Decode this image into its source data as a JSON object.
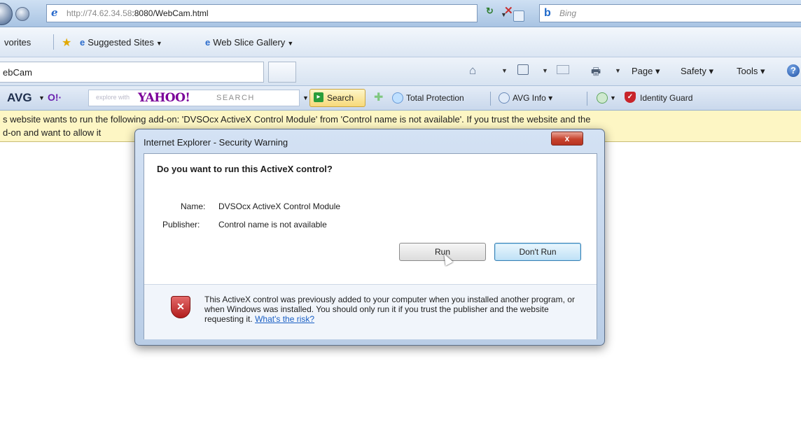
{
  "browser": {
    "url_host": "http://74.62.34.58",
    "url_path": ":8080/WebCam.html",
    "search_placeholder": "Bing"
  },
  "favorites_bar": {
    "label": "vorites",
    "suggested_sites": "Suggested Sites",
    "web_slice_gallery": "Web Slice Gallery"
  },
  "tab": {
    "title": "ebCam"
  },
  "command_bar": {
    "page": "Page ▾",
    "safety": "Safety ▾",
    "tools": "Tools ▾",
    "help": "?"
  },
  "avg_toolbar": {
    "logo": "AVG",
    "yahoo_hint": "explore with",
    "yahoo_logo": "YAHOO!",
    "yahoo_search": "SEARCH",
    "search_button": "Search",
    "total_protection": "Total Protection",
    "avg_info": "AVG Info ▾",
    "identity_guard": "Identity Guard"
  },
  "info_bar": {
    "line1": "s website wants to run the following add-on: 'DVSOcx ActiveX Control Module' from 'Control name is not available'. If you trust the website and the",
    "line2": "d-on and want to allow it"
  },
  "dialog": {
    "title": "Internet Explorer - Security Warning",
    "close": "x",
    "question": "Do you want to run this ActiveX control?",
    "name_label": "Name:",
    "name_value": "DVSOcx ActiveX Control Module",
    "publisher_label": "Publisher:",
    "publisher_value": "Control name is not available",
    "run_button": "Run",
    "dont_run_button": "Don't Run",
    "footer_text": "This ActiveX control was previously added to your computer when you installed another program, or when Windows was installed. You should only run it if you trust the publisher and the website requesting it.",
    "risk_link": "What's the risk?"
  },
  "icons": {
    "back": "back-icon",
    "forward": "forward-icon",
    "shield": "shield-warning-icon"
  },
  "colors": {
    "info_bar_bg": "#fdf6c4",
    "close_button": "#c7432d",
    "link": "#1a5fc4"
  }
}
